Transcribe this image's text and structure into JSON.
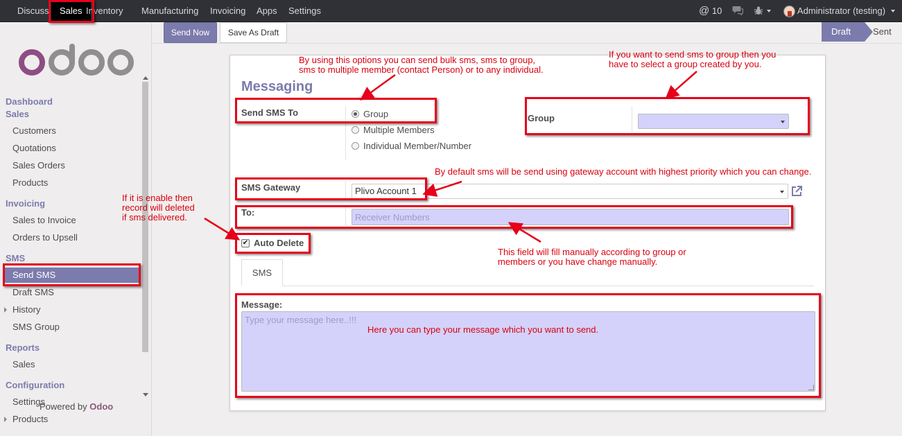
{
  "topbar": {
    "menus": [
      "Discuss",
      "Sales",
      "Inventory",
      "Manufacturing",
      "Invoicing",
      "Apps",
      "Settings"
    ],
    "active_menu": "Sales",
    "notifications": "10",
    "user": "Administrator (testing)"
  },
  "logo": "odoo",
  "sidebar": {
    "dashboard": "Dashboard",
    "sections": [
      {
        "title": "Sales",
        "items": [
          "Customers",
          "Quotations",
          "Sales Orders",
          "Products"
        ]
      },
      {
        "title": "Invoicing",
        "items": [
          "Sales to Invoice",
          "Orders to Upsell"
        ]
      },
      {
        "title": "SMS",
        "items": [
          "Send SMS",
          "Draft SMS",
          "History",
          "SMS Group"
        ]
      },
      {
        "title": "Reports",
        "items": [
          "Sales"
        ]
      },
      {
        "title": "Configuration",
        "items": [
          "Settings",
          "Products"
        ]
      }
    ],
    "active_item": "Send SMS",
    "powered_by": "Powered by",
    "powered_brand": "Odoo"
  },
  "control_panel": {
    "send_now": "Send Now",
    "save_as_draft": "Save As Draft",
    "statuses": [
      "Draft",
      "Sent"
    ],
    "active_status": "Draft"
  },
  "form": {
    "title": "Messaging",
    "send_sms_to_label": "Send SMS To",
    "send_options": [
      "Group",
      "Multiple Members",
      "Individual Member/Number"
    ],
    "selected_option": "Group",
    "group_label": "Group",
    "group_value": "",
    "gateway_label": "SMS Gateway",
    "gateway_value": "Plivo Account 1",
    "to_label": "To:",
    "to_placeholder": "Receiver Numbers",
    "auto_delete_label": "Auto Delete",
    "auto_delete_checked": true,
    "tab_label": "SMS",
    "message_label": "Message:",
    "message_placeholder": "Type your message here..!!!"
  },
  "annotations": {
    "options_note_1": "By using this options you can send bulk sms, sms to group,",
    "options_note_2": "sms to multiple member (contact Person) or to any individual.",
    "group_note_1": "If you want to send sms to group then you",
    "group_note_2": "have to select a group created by you.",
    "gateway_note": "By default sms will be send using gateway account with highest priority which you can change.",
    "delete_note_1": "If it is enable then",
    "delete_note_2": "record will deleted",
    "delete_note_3": "if sms delivered.",
    "to_note_1": "This field will fill manually according to group or",
    "to_note_2": "members or you have change manually.",
    "message_note": "Here you can type your message which you want to send."
  },
  "colors": {
    "accent": "#7c7bad",
    "annotation": "#e6001a",
    "field_bg": "#d4d2fb"
  }
}
